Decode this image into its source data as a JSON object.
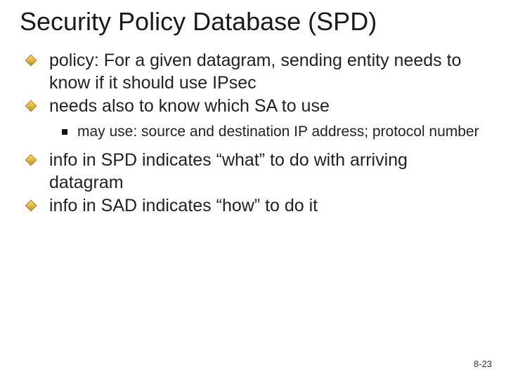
{
  "title": "Security Policy Database (SPD)",
  "bullets": {
    "b1": "policy: For a given datagram, sending entity needs to know if it should use IPsec",
    "b2": "needs also to know which SA to use",
    "b2a": "may use: source and destination IP address; protocol number",
    "b3": "info in SPD indicates “what” to do with arriving datagram",
    "b4": "info in SAD indicates “how” to do it"
  },
  "footer": "8-23"
}
